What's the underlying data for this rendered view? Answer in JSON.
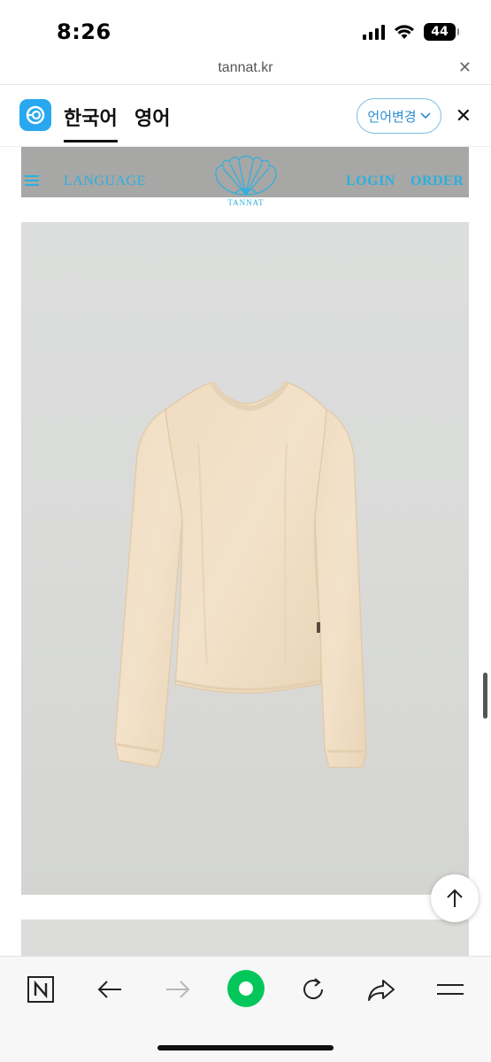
{
  "status_bar": {
    "time": "8:26",
    "battery": "44"
  },
  "url_bar": {
    "domain": "tannat.kr",
    "close_icon": "close-icon"
  },
  "translate_bar": {
    "source_language": "한국어",
    "target_language": "영어",
    "change_language_label": "언어변경",
    "accent_color": "#27a8f0"
  },
  "site_header": {
    "menu_icon": "hamburger-icon",
    "language_label": "LANGUAGE",
    "logo_text": "TANNAT",
    "login_label": "LOGIN",
    "order_label": "ORDER",
    "link_color": "#2ab0e0"
  },
  "toolbar": {
    "items": [
      "naver-icon",
      "back-arrow-icon",
      "forward-arrow-icon",
      "green-dot-icon",
      "reload-icon",
      "share-icon",
      "menu-icon"
    ],
    "accent_color": "#03c75a"
  }
}
